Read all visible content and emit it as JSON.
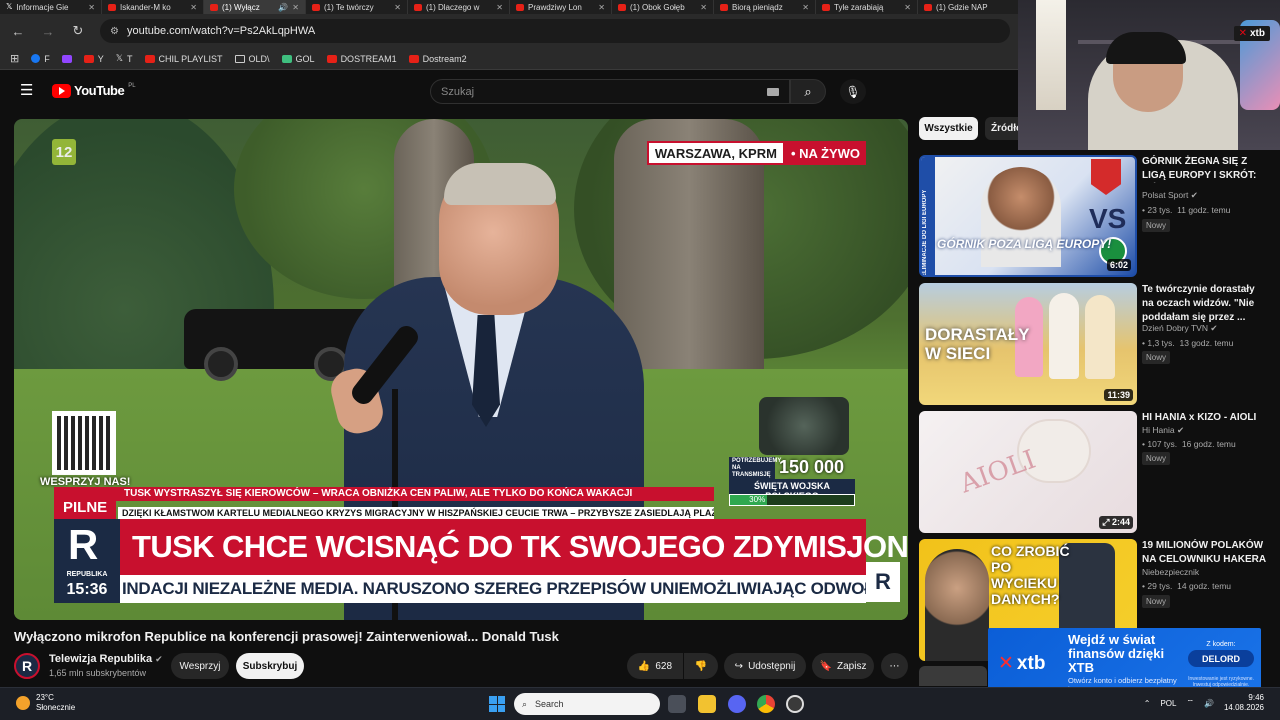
{
  "tabs": [
    {
      "label": "Informacje Gie",
      "icon": "x-logo-icon",
      "active": false
    },
    {
      "label": "Iskander-M ko",
      "icon": "youtube-icon",
      "active": false
    },
    {
      "label": "(1) Wyłącz",
      "icon": "youtube-icon",
      "active": true
    },
    {
      "label": "(1) Te twórczy",
      "icon": "youtube-icon",
      "active": false
    },
    {
      "label": "(1) Dlaczego w",
      "icon": "youtube-icon",
      "active": false
    },
    {
      "label": "Prawdziwy Lon",
      "icon": "youtube-icon",
      "active": false
    },
    {
      "label": "(1) Obok Gołęb",
      "icon": "youtube-icon",
      "active": false
    },
    {
      "label": "Biorą pieniądz",
      "icon": "youtube-icon",
      "active": false
    },
    {
      "label": "Tyle zarabiają",
      "icon": "youtube-icon",
      "active": false
    },
    {
      "label": "(1) Gdzie NAP",
      "icon": "youtube-icon",
      "active": false
    }
  ],
  "address": {
    "url": "youtube.com/watch?v=Ps2AkLqpHWA"
  },
  "bookmarks": [
    {
      "label": "F",
      "icon": "facebook-icon"
    },
    {
      "label": "",
      "icon": "twitch-icon"
    },
    {
      "label": "Y",
      "icon": "youtube-icon"
    },
    {
      "label": "T",
      "icon": "x-logo-icon"
    },
    {
      "label": "CHIL PLAYLIST",
      "icon": "youtube-icon"
    },
    {
      "label": "OLD\\",
      "icon": "folder-icon"
    },
    {
      "label": "GOL",
      "icon": "gol-icon"
    },
    {
      "label": "DOSTREAM1",
      "icon": "youtube-icon"
    },
    {
      "label": "Dostream2",
      "icon": "youtube-icon"
    }
  ],
  "youtube": {
    "logo_text": "YouTube",
    "country_code": "PL",
    "search_placeholder": "Szukaj"
  },
  "video": {
    "channel_badge": "12",
    "location": "WARSZAWA, KPRM",
    "live_label": "• NA ŻYWO",
    "qr_label": "WESPRZYJ NAS!",
    "donation_top": "POTRZEBUJEMY NA TRANSMISJĘ",
    "donation_amount": "150 000 zł",
    "donation_goal": "ŚWIĘTA WOJSKA POLSKIEGO",
    "donation_percent": "30%",
    "donation_fraction": 0.3,
    "crawl_top": "TUSK WYSTRASZYŁ SIĘ KIEROWCÓW – WRACA OBNIŻKA CEN PALIW, ALE TYLKO DO KOŃCA WAKACJI",
    "breaking_label": "PILNE",
    "crawl_sub": "DZIĘKI KŁAMSTWOM KARTELU MEDIALNEGO KRYZYS MIGRACYJNY W HISZPAŃSKIEJ CEUCIE TRWA – PRZYBYSZE ZASIEDLAJĄ PLAŻE",
    "logo_letter": "R",
    "logo_name": "REPUBLIKA",
    "clock": "15:36",
    "headline": "TUSK CHCE WCISNĄĆ DO TK SWOJEGO ZDYMISJONOWANEGO MINISTRA",
    "ticker": "INDACJI NIEZALEŻNE MEDIA. NARUSZONO SZEREG PRZEPISÓW UNIEMOŻLIWIAJĄC ODWOŁANIE SĄDOWE"
  },
  "watch": {
    "title": "Wyłączono mikrofon Republice na konferencji prasowej! Zainterweniował... Donald Tusk",
    "channel": "Telewizja Republika",
    "subscribers": "1,65 mln subskrybentów",
    "support_label": "Wesprzyj",
    "subscribe_label": "Subskrybuj",
    "likes": "628",
    "share_label": "Udostępnij",
    "save_label": "Zapisz"
  },
  "filters": {
    "all": "Wszystkie",
    "source": "Źródło"
  },
  "recommendations": [
    {
      "title": "GÓRNIK ŻEGNA SIĘ Z LIGĄ EUROPY I SKRÓT: GÓRNIK ZABRZE - FERENCVAROS I ...",
      "channel": "Polsat Sport",
      "views": "23 tys.",
      "age": "11 godz. temu",
      "badge": "Nowy",
      "duration": "6:02",
      "thumb_text": "GÓRNIK POZA LIGĄ EUROPY!",
      "thumb_vs": "VS",
      "thumb_side": "ELIMINACJE DO LIGI EUROPY"
    },
    {
      "title": "Te twórczynie dorastały na oczach widzów. \"Nie poddałam się przez ...",
      "channel": "Dzień Dobry TVN",
      "views": "1,3 tys.",
      "age": "13 godz. temu",
      "badge": "Nowy",
      "duration": "11:39",
      "thumb_text": "DORASTAŁY W SIECI"
    },
    {
      "title": "HI HANIA x KIZO - AIOLI",
      "channel": "Hi Hania",
      "views": "107 tys.",
      "age": "16 godz. temu",
      "badge": "Nowy",
      "duration": "2:44",
      "thumb_text": "AIOLI"
    },
    {
      "title": "19 MILIONÓW POLAKÓW NA CELOWNIKU HAKERA",
      "channel": "Niebezpiecznik",
      "views": "29 tys.",
      "age": "14 godz. temu",
      "badge": "Nowy",
      "duration": "",
      "thumb_text": "CO ZROBIĆ PO WYCIEKU DANYCH?"
    }
  ],
  "webcam": {
    "brand": "xtb"
  },
  "ad": {
    "brand": "xtb",
    "headline": "Wejdź w świat finansów dzięki XTB",
    "sub": "Otwórz konto i odbierz bezpłatny kurs",
    "code_label": "Z kodem:",
    "code": "DELORD",
    "disclaimer": "Inwestowanie jest ryzykowne. Inwestuj odpowiedzialnie."
  },
  "taskbar": {
    "temperature": "23°C",
    "weather": "Słonecznie",
    "search_placeholder": "Search",
    "language": "POL",
    "time": "9:46",
    "date": "14.08.2026"
  }
}
